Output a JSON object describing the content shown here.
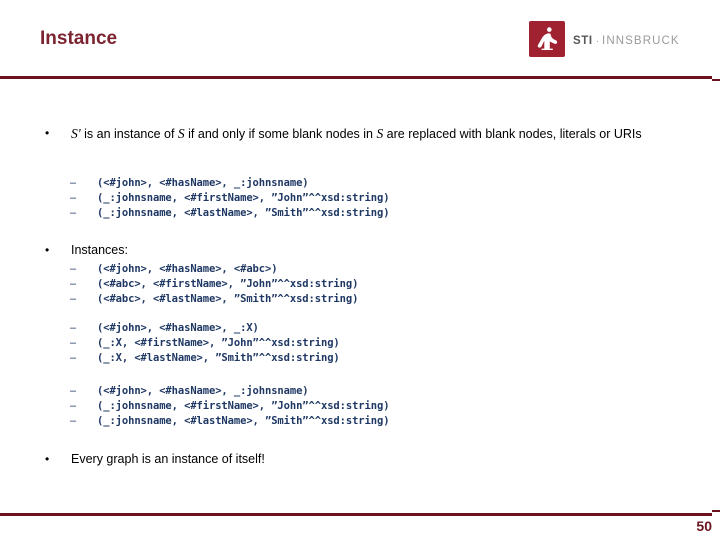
{
  "slide": {
    "title": "Instance",
    "page_number": "50",
    "accent_color": "#6B1420",
    "title_color": "#7B2430",
    "code_color": "#1F3864"
  },
  "logo": {
    "mark_color": "#A02230",
    "sti": "STI",
    "separator": "·",
    "innsbruck": "INNSBRUCK"
  },
  "bullets": [
    {
      "marker": "•",
      "text_pre": "",
      "text": "S' is an instance of S if and only if some blank nodes in S are replaced with blank nodes, literals or URIs"
    },
    {
      "marker": "•",
      "text": "Instances:"
    },
    {
      "marker": "•",
      "text": "Every graph is an instance of itself!"
    }
  ],
  "code_groups": [
    {
      "name": "definition-example",
      "lines": [
        {
          "dash": "–",
          "code": "(<#john>, <#hasName>, _:johnsname)"
        },
        {
          "dash": "–",
          "code": "(_:johnsname, <#firstName>, ”John”^^xsd:string)"
        },
        {
          "dash": "–",
          "code": "(_:johnsname, <#lastName>, ”Smith”^^xsd:string)"
        }
      ]
    },
    {
      "name": "instance-uri-abc",
      "lines": [
        {
          "dash": "–",
          "code": "(<#john>, <#hasName>, <#abc>)"
        },
        {
          "dash": "–",
          "code": "(<#abc>, <#firstName>, ”John”^^xsd:string)"
        },
        {
          "dash": "–",
          "code": "(<#abc>, <#lastName>, ”Smith”^^xsd:string)"
        }
      ]
    },
    {
      "name": "instance-blank-x",
      "lines": [
        {
          "dash": "–",
          "code": "(<#john>, <#hasName>, _:X)"
        },
        {
          "dash": "–",
          "code": "(_:X, <#firstName>, ”John”^^xsd:string)"
        },
        {
          "dash": "–",
          "code": "(_:X, <#lastName>, ”Smith”^^xsd:string)"
        }
      ]
    },
    {
      "name": "instance-blank-johnsname",
      "lines": [
        {
          "dash": "–",
          "code": "(<#john>, <#hasName>, _:johnsname)"
        },
        {
          "dash": "–",
          "code": "(_:johnsname, <#firstName>, ”John”^^xsd:string)"
        },
        {
          "dash": "–",
          "code": "(_:johnsname, <#lastName>, ”Smith”^^xsd:string)"
        }
      ]
    }
  ]
}
